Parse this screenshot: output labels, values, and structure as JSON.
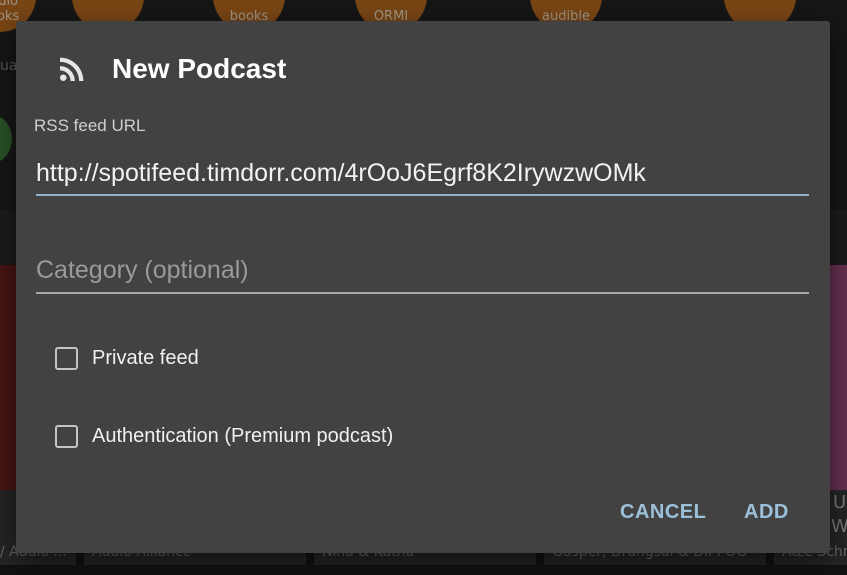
{
  "background": {
    "top_circles": [
      "audio books",
      "",
      "books",
      "ORMI",
      "audible",
      ""
    ],
    "side_text": "ua",
    "captions": [
      "/ Audio ...",
      "Audio Alliance",
      "Nina & Katha",
      "Gasper, Drangsal & DIPPOG",
      "Atze Schr"
    ],
    "card_peek_texts": [
      "U",
      "W"
    ]
  },
  "dialog": {
    "title": "New Podcast",
    "title_icon": "rss-feed-icon",
    "rss_label": "RSS feed URL",
    "rss_value": "http://spotifeed.timdorr.com/4rOoJ6Egrf8K2IrywzwOMk",
    "category_placeholder": "Category (optional)",
    "category_value": "",
    "private_feed_label": "Private feed",
    "private_feed_checked": false,
    "auth_label": "Authentication (Premium podcast)",
    "auth_checked": false,
    "cancel_label": "CANCEL",
    "add_label": "ADD"
  },
  "colors": {
    "dialog_bg": "#424242",
    "accent": "#9cc0da",
    "active_underline": "#8fb2cc"
  }
}
